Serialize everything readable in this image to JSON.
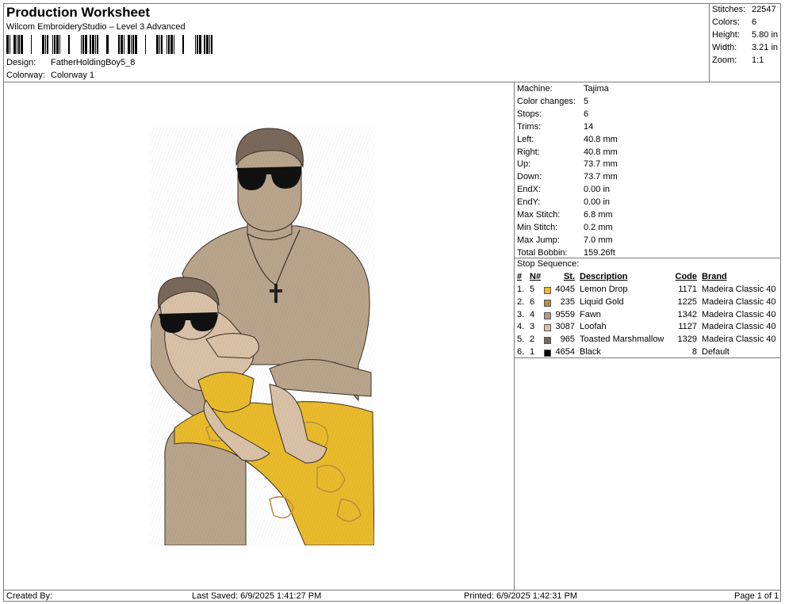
{
  "header": {
    "title": "Production Worksheet",
    "software": "Wilcom EmbroideryStudio – Level 3 Advanced",
    "design_label": "Design:",
    "design_value": "FatherHoldingBoy5_8",
    "colorway_label": "Colorway:",
    "colorway_value": "Colorway 1"
  },
  "summary": [
    {
      "label": "Stitches:",
      "value": "22547"
    },
    {
      "label": "Colors:",
      "value": "6"
    },
    {
      "label": "Height:",
      "value": "5.80 in"
    },
    {
      "label": "Width:",
      "value": "3.21 in"
    },
    {
      "label": "Zoom:",
      "value": "1:1"
    }
  ],
  "machine_info": [
    {
      "label": "Machine:",
      "value": "Tajima"
    },
    {
      "label": "Color changes:",
      "value": "5"
    },
    {
      "label": "Stops:",
      "value": "6"
    },
    {
      "label": "Trims:",
      "value": "14"
    },
    {
      "label": "Left:",
      "value": "40.8 mm"
    },
    {
      "label": "Right:",
      "value": "40.8 mm"
    },
    {
      "label": "Up:",
      "value": "73.7 mm"
    },
    {
      "label": "Down:",
      "value": "73.7 mm"
    },
    {
      "label": "EndX:",
      "value": "0.00 in"
    },
    {
      "label": "EndY:",
      "value": "0.00 in"
    },
    {
      "label": "Max Stitch:",
      "value": "6.8 mm"
    },
    {
      "label": "Min Stitch:",
      "value": "0.2 mm"
    },
    {
      "label": "Max Jump:",
      "value": "7.0 mm"
    },
    {
      "label": "Total Bobbin:",
      "value": "159.26ft"
    }
  ],
  "stop_sequence": {
    "title": "Stop Sequence:",
    "headers": {
      "num": "#",
      "n": "N#",
      "st": "St.",
      "description": "Description",
      "code": "Code",
      "brand": "Brand"
    },
    "rows": [
      {
        "idx": "1.",
        "n": "5",
        "color": "#f2b830",
        "st": "4045",
        "description": "Lemon Drop",
        "code": "1171",
        "brand": "Madeira Classic 40"
      },
      {
        "idx": "2.",
        "n": "6",
        "color": "#b98f3f",
        "st": "235",
        "description": "Liquid Gold",
        "code": "1225",
        "brand": "Madeira Classic 40"
      },
      {
        "idx": "3.",
        "n": "4",
        "color": "#b09a85",
        "st": "9559",
        "description": "Fawn",
        "code": "1342",
        "brand": "Madeira Classic 40"
      },
      {
        "idx": "4.",
        "n": "3",
        "color": "#d9c1a8",
        "st": "3087",
        "description": "Loofah",
        "code": "1127",
        "brand": "Madeira Classic 40"
      },
      {
        "idx": "5.",
        "n": "2",
        "color": "#7a685a",
        "st": "965",
        "description": "Toasted Marshmallow",
        "code": "1329",
        "brand": "Madeira Classic 40"
      },
      {
        "idx": "6.",
        "n": "1",
        "color": "#000000",
        "st": "4654",
        "description": "Black",
        "code": "8",
        "brand": "Default"
      }
    ]
  },
  "footer": {
    "created_by": "Created By:",
    "last_saved": "Last Saved: 6/9/2025 1:41:27 PM",
    "printed": "Printed: 6/9/2025 1:42:31 PM",
    "page": "Page 1 of 1"
  },
  "design_colors": {
    "skin": "#b9a48c",
    "skin_light": "#d9c1a8",
    "hair": "#7a685a",
    "shorts": "#e9bb2c",
    "shorts_pattern": "#b98f3f",
    "outline": "#3a3028"
  }
}
